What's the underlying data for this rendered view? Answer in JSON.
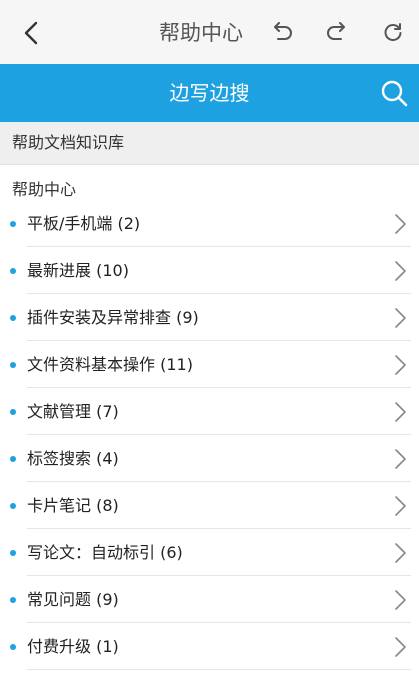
{
  "header": {
    "title": "帮助中心",
    "back_icon": "chevron-left-icon",
    "undo_icon": "undo-icon",
    "redo_icon": "redo-icon",
    "refresh_icon": "refresh-icon"
  },
  "search": {
    "label": "边写边搜",
    "icon": "search-icon"
  },
  "section": {
    "title": "帮助文档知识库"
  },
  "group": {
    "title": "帮助中心"
  },
  "items": [
    {
      "label": "平板/手机端 (2)"
    },
    {
      "label": "最新进展 (10)"
    },
    {
      "label": "插件安装及异常排查 (9)"
    },
    {
      "label": "文件资料基本操作 (11)"
    },
    {
      "label": "文献管理 (7)"
    },
    {
      "label": "标签搜索 (4)"
    },
    {
      "label": "卡片笔记 (8)"
    },
    {
      "label": "写论文：自动标引 (6)"
    },
    {
      "label": "常见问题 (9)"
    },
    {
      "label": "付费升级 (1)"
    }
  ],
  "colors": {
    "accent": "#1ea1e0",
    "topbar_bg": "#f6f6f6",
    "section_bg": "#efefef"
  }
}
